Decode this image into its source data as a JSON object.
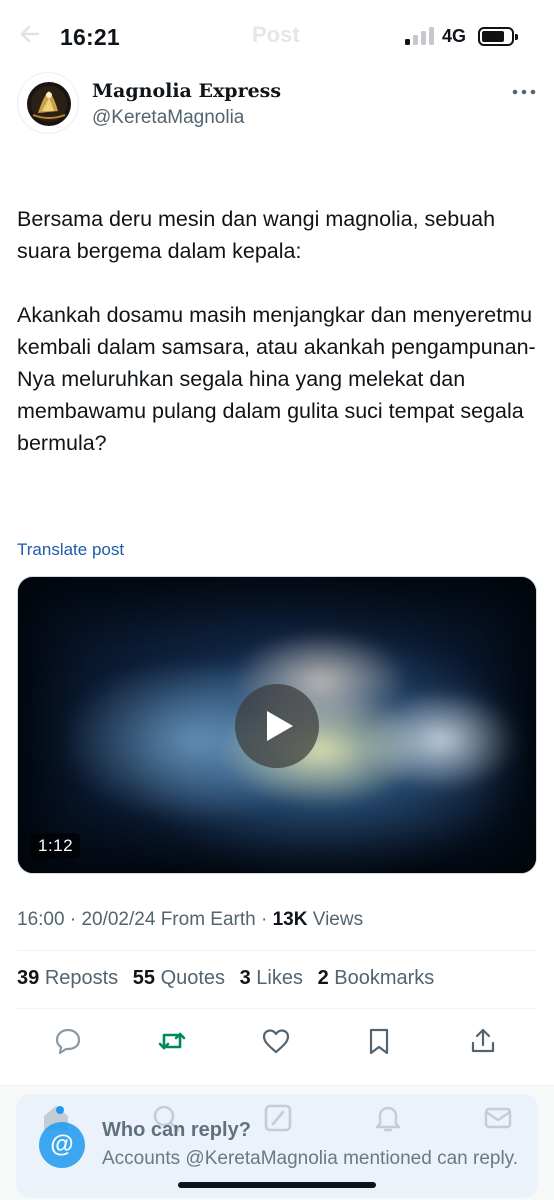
{
  "status_bar": {
    "time": "16:21",
    "network": "4G",
    "signal_bars_active": 1,
    "signal_bars_total": 4,
    "battery_level": 0.85
  },
  "nav": {
    "title": "Post",
    "back_icon": "arrow-left-icon"
  },
  "author": {
    "name": "Magnolia Express",
    "handle": "@KeretaMagnolia",
    "more_icon": "more-horizontal-icon"
  },
  "tweet": {
    "paragraphs": [
      "Bersama deru mesin dan wangi magnolia, sebuah suara bergema dalam kepala:",
      "Akankah dosamu masih menjangkar dan menyeretmu kembali dalam samsara, atau akankah pengampunan-Nya meluruhkan segala hina yang melekat dan membawamu pulang dalam gulita suci tempat segala bermula?"
    ],
    "translate_label": "Translate post"
  },
  "media": {
    "type": "video",
    "duration": "1:12",
    "play_icon": "play-icon"
  },
  "meta": {
    "time": "16:00",
    "date": "20/02/24",
    "source": "From Earth",
    "views_count": "13K",
    "views_label": "Views",
    "sep": "·"
  },
  "stats": [
    {
      "count": "39",
      "label": "Reposts"
    },
    {
      "count": "55",
      "label": "Quotes"
    },
    {
      "count": "3",
      "label": "Likes"
    },
    {
      "count": "2",
      "label": "Bookmarks"
    }
  ],
  "actions": [
    {
      "name": "reply-icon",
      "color": "#8899a6"
    },
    {
      "name": "repost-icon",
      "color": "#00875a"
    },
    {
      "name": "like-icon",
      "color": "#536471"
    },
    {
      "name": "bookmark-icon",
      "color": "#536471"
    },
    {
      "name": "share-icon",
      "color": "#536471"
    }
  ],
  "reply_restriction": {
    "title": "Who can reply?",
    "subtitle": "Accounts @KeretaMagnolia mentioned can reply.",
    "icon": "at-icon",
    "accent": "#1d9bf0"
  },
  "tab_bar": [
    "home-icon",
    "search-icon",
    "grok-icon",
    "notifications-icon",
    "messages-icon"
  ]
}
